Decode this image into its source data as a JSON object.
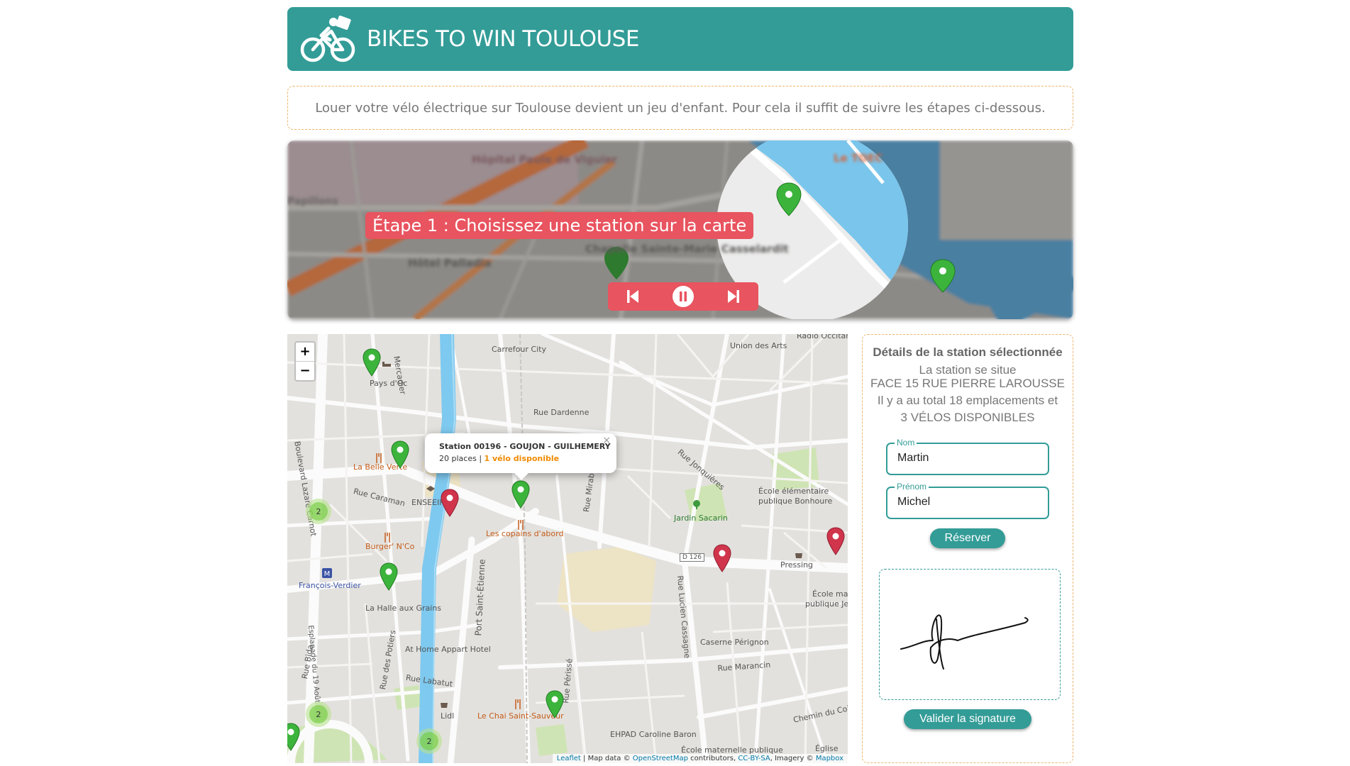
{
  "header": {
    "title": "BIKES TO WIN TOULOUSE",
    "logo_icon": "cyclist-icon"
  },
  "intro": {
    "text": "Louer votre vélo électrique sur Toulouse devient un jeu d'enfant. Pour cela il suffit de suivre les étapes ci-dessous."
  },
  "slider": {
    "caption": "Étape 1 : Choisissez une station sur la carte",
    "map_labels": [
      "Hôpital Paule de Viguier",
      "Le TOEC",
      "Hôtel Palladia",
      "Chapelle Sainte-Marie Casselardit",
      "Papillons"
    ],
    "controls": {
      "prev_icon": "skip-previous-icon",
      "pause_icon": "pause-icon",
      "next_icon": "skip-next-icon"
    }
  },
  "map": {
    "zoom_in": "+",
    "zoom_out": "−",
    "labels": {
      "carrefour": "Carrefour City",
      "union": "Union des Arts",
      "radio": "Radio Occitan",
      "paysdoc": "Pays d'Oc",
      "mercadier": "Mercadier",
      "dardenne": "Rue Dardenne",
      "jonquieres": "Rue Jonquières",
      "belleverte": "La Belle Verte",
      "caraman": "Rue Caraman",
      "enseeiht": "ENSEEIHT",
      "ecole1": "École élémentaire",
      "ecole1b": "publique Bonhoure",
      "jardin": "Jardin Sacarin",
      "burger": "Burger' N'Co",
      "copains": "Les copains d'abord",
      "mirabeau": "Rue Mirabeau",
      "d126": "D 126",
      "pressing": "Pressing",
      "verdier": "François-Verdier",
      "lazare": "Boulevard Lazare Carnot",
      "halle": "La Halle aux Grains",
      "portse": "Port Saint-Étienne",
      "cassagne": "Rue Lucien Cassagne",
      "ecole2": "École mat",
      "ecole2b": "publique Jea",
      "athome": "At Home Appart Hotel",
      "perignon": "Caserne Pérignon",
      "potiers": "Rue des Potiers",
      "labatut": "Rue Labatut",
      "marancin": "Rue Marancin",
      "bida": "Rue Bida",
      "esplanade": "Esplanade du 19 Août",
      "perisse": "Rue Périssé",
      "lidl": "Lidl",
      "chai": "Le Chai Saint-Sauveur",
      "ehpad": "EHPAD Caroline Baron",
      "chemin": "Chemin du Coi",
      "ecole3": "École maternelle publique",
      "eglise": "Église"
    },
    "clusters": [
      "2",
      "2",
      "2"
    ],
    "popup": {
      "title": "Station 00196 - GOUJON - GUILHEMERY",
      "places": "20 places",
      "separator": " | ",
      "available": "1 vélo disponible",
      "close": "×"
    },
    "attribution": {
      "leaflet": "Leaflet",
      "text1": " | Map data © ",
      "osm": "OpenStreetMap",
      "text2": " contributors, ",
      "ccbysa": "CC-BY-SA",
      "text3": ", Imagery © ",
      "mapbox": "Mapbox"
    },
    "colors": {
      "available_marker": "#3cb43c",
      "empty_marker": "#d0354c",
      "water": "#7ec9ef",
      "park": "#cfe4b4",
      "campus": "#ede3c5"
    }
  },
  "panel": {
    "title": "Détails de la station sélectionnée",
    "line1": "La station se situe",
    "line2": "FACE 15 RUE PIERRE LAROUSSE",
    "line3": "Il y a au total 18 emplacements et",
    "line4": "3 VÉLOS DISPONIBLES",
    "nom_label": "Nom",
    "nom_value": "Martin",
    "prenom_label": "Prénom",
    "prenom_value": "Michel",
    "reserve_button": "Réserver",
    "validate_button": "Valider la signature"
  },
  "colors": {
    "brand": "#339c97",
    "accent": "#e8545f",
    "dashed_border": "#f0b56a"
  }
}
